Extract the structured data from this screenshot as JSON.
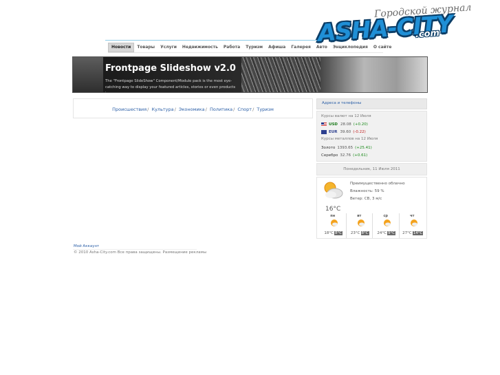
{
  "logo": {
    "tagline": "Городской журнал",
    "name": "ASHA-CITY",
    "domain": ".com"
  },
  "menu": {
    "items": [
      {
        "label": "Новости",
        "active": true
      },
      {
        "label": "Товары"
      },
      {
        "label": "Услуги"
      },
      {
        "label": "Недвижимость"
      },
      {
        "label": "Работа"
      },
      {
        "label": "Туризм"
      },
      {
        "label": "Афиша"
      },
      {
        "label": "Галерея"
      },
      {
        "label": "Авто"
      },
      {
        "label": "Энциклопедия"
      },
      {
        "label": "О сайте"
      }
    ]
  },
  "slideshow": {
    "title": "Frontpage Slideshow v2.0",
    "text": "The \"Frontpage SlideShow\" Component/Module pack is the most eye-catching way to display your featured articles, stories or even products in..."
  },
  "categories": {
    "items": [
      "Происшествия",
      "Культура",
      "Экономика",
      "Политика",
      "Спорт",
      "Туризм"
    ],
    "separator": "/"
  },
  "sidebar": {
    "links_label": "Адреса и телефоны",
    "currency_title": "Курсы валют на 12 Июля",
    "usd": {
      "code": "USD",
      "value": "28.08",
      "delta": "(+0.20)"
    },
    "eur": {
      "code": "EUR",
      "value": "39.60",
      "delta": "(-0.22)"
    },
    "metals_title": "Курсы металлов на 12 Июля",
    "gold": {
      "name": "Золото",
      "value": "1393.65",
      "delta": "(+25.41)"
    },
    "silver": {
      "name": "Серебро",
      "value": "32.76",
      "delta": "(+0.61)"
    },
    "date": "Понедельник, 11 Июля 2011"
  },
  "weather": {
    "condition": "Преимущественно облачно",
    "humidity": "Влажность: 59 %",
    "wind": "Ветер: СВ, 3 м/с",
    "temp": "16°C",
    "forecast": [
      {
        "day": "пн",
        "high": "18°C",
        "low": "8°C"
      },
      {
        "day": "вт",
        "high": "23°C",
        "low": "8°C"
      },
      {
        "day": "ср",
        "high": "24°C",
        "low": "9°C"
      },
      {
        "day": "чт",
        "high": "27°C",
        "low": "14°C"
      }
    ]
  },
  "footer": {
    "account_link": "Мой Аккаунт",
    "copyright": "© 2010 Asha-City.com Все права защищены. Размещение рекламы"
  },
  "colors": {
    "link": "#2b5fa7",
    "logo_blue": "#1f8fd6",
    "positive": "#1a8a1a",
    "negative": "#c02020"
  }
}
